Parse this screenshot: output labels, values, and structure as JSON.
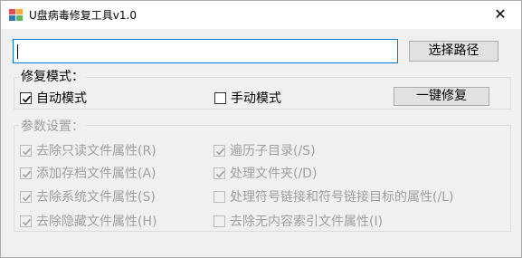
{
  "window": {
    "title": "U盘病毒修复工具v1.0",
    "close_glyph": "✕"
  },
  "path": {
    "value": "",
    "browse_label": "选择路径"
  },
  "repair_mode": {
    "label": "修复模式：",
    "auto_label": "自动模式",
    "auto_checked": true,
    "manual_label": "手动模式",
    "manual_checked": false,
    "repair_button": "一键修复"
  },
  "params": {
    "label": "参数设置：",
    "options": [
      {
        "label": "去除只读文件属性(R)",
        "checked": true,
        "enabled": false
      },
      {
        "label": "添加存档文件属性(A)",
        "checked": true,
        "enabled": false
      },
      {
        "label": "去除系统文件属性(S)",
        "checked": true,
        "enabled": false
      },
      {
        "label": "去除隐藏文件属性(H)",
        "checked": true,
        "enabled": false
      },
      {
        "label": "遍历子目录(/S)",
        "checked": true,
        "enabled": false
      },
      {
        "label": "处理文件夹(/D)",
        "checked": true,
        "enabled": false
      },
      {
        "label": "处理符号链接和符号链接目标的属性(/L)",
        "checked": false,
        "enabled": false
      },
      {
        "label": "去除无内容索引文件属性(I)",
        "checked": false,
        "enabled": false
      }
    ]
  },
  "icons": {
    "app": "app-icon",
    "close": "close-icon",
    "check": "check-icon"
  },
  "colors": {
    "focus_border": "#0078d7",
    "disabled_text": "#a0a0a0",
    "button_face": "#e1e1e1"
  }
}
